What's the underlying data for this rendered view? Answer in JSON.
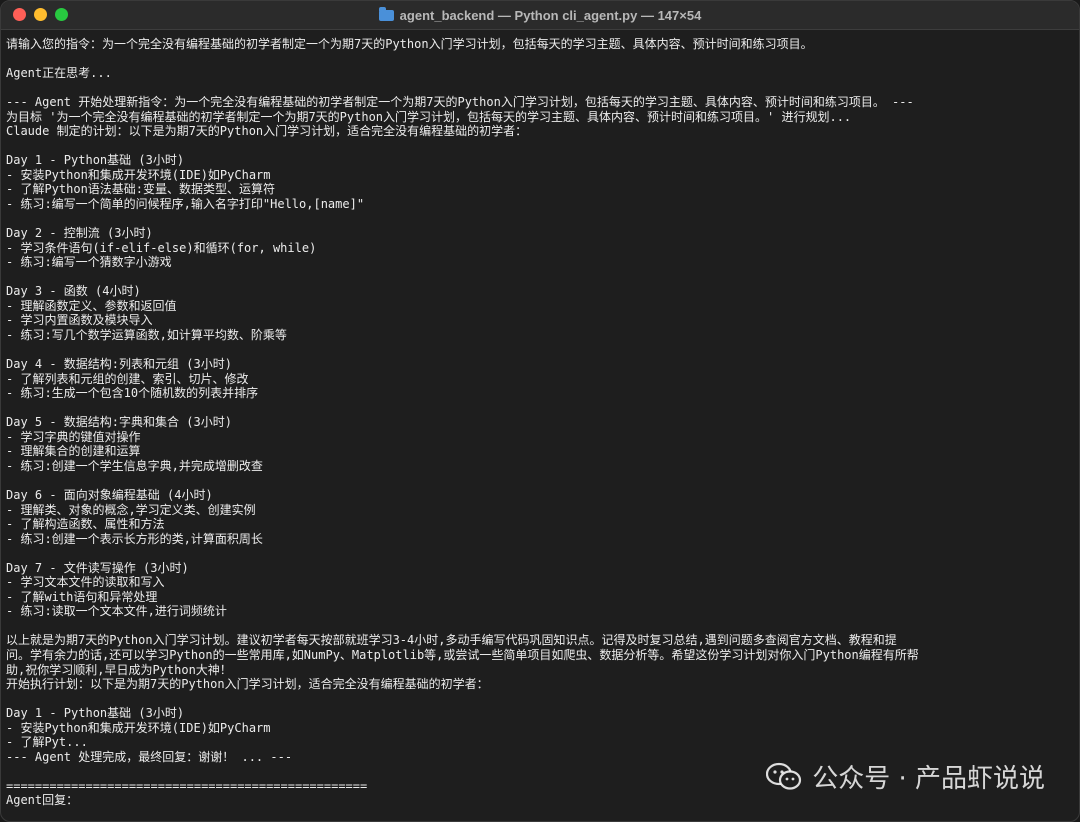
{
  "window": {
    "title": "agent_backend — Python cli_agent.py — 147×54"
  },
  "terminal": {
    "lines": [
      "请输入您的指令：为一个完全没有编程基础的初学者制定一个为期7天的Python入门学习计划，包括每天的学习主题、具体内容、预计时间和练习项目。",
      "",
      "Agent正在思考...",
      "",
      "--- Agent 开始处理新指令：为一个完全没有编程基础的初学者制定一个为期7天的Python入门学习计划，包括每天的学习主题、具体内容、预计时间和练习项目。 ---",
      "为目标 '为一个完全没有编程基础的初学者制定一个为期7天的Python入门学习计划，包括每天的学习主题、具体内容、预计时间和练习项目。' 进行规划...",
      "Claude 制定的计划：以下是为期7天的Python入门学习计划，适合完全没有编程基础的初学者：",
      "",
      "Day 1 - Python基础 (3小时)",
      "- 安装Python和集成开发环境(IDE)如PyCharm",
      "- 了解Python语法基础:变量、数据类型、运算符",
      "- 练习:编写一个简单的问候程序,输入名字打印\"Hello,[name]\"",
      "",
      "Day 2 - 控制流 (3小时)",
      "- 学习条件语句(if-elif-else)和循环(for, while)",
      "- 练习:编写一个猜数字小游戏",
      "",
      "Day 3 - 函数 (4小时)",
      "- 理解函数定义、参数和返回值",
      "- 学习内置函数及模块导入",
      "- 练习:写几个数学运算函数,如计算平均数、阶乘等",
      "",
      "Day 4 - 数据结构:列表和元组 (3小时)",
      "- 了解列表和元组的创建、索引、切片、修改",
      "- 练习:生成一个包含10个随机数的列表并排序",
      "",
      "Day 5 - 数据结构:字典和集合 (3小时)",
      "- 学习字典的键值对操作",
      "- 理解集合的创建和运算",
      "- 练习:创建一个学生信息字典,并完成增删改查",
      "",
      "Day 6 - 面向对象编程基础 (4小时)",
      "- 理解类、对象的概念,学习定义类、创建实例",
      "- 了解构造函数、属性和方法",
      "- 练习:创建一个表示长方形的类,计算面积周长",
      "",
      "Day 7 - 文件读写操作 (3小时)",
      "- 学习文本文件的读取和写入",
      "- 了解with语句和异常处理",
      "- 练习:读取一个文本文件,进行词频统计",
      "",
      "以上就是为期7天的Python入门学习计划。建议初学者每天按部就班学习3-4小时,多动手编写代码巩固知识点。记得及时复习总结,遇到问题多查阅官方文档、教程和提",
      "问。学有余力的话,还可以学习Python的一些常用库,如NumPy、Matplotlib等,或尝试一些简单项目如爬虫、数据分析等。希望这份学习计划对你入门Python编程有所帮",
      "助,祝你学习顺利,早日成为Python大神！",
      "开始执行计划：以下是为期7天的Python入门学习计划，适合完全没有编程基础的初学者：",
      "",
      "Day 1 - Python基础 (3小时)",
      "- 安装Python和集成开发环境(IDE)如PyCharm",
      "- 了解Pyt...",
      "--- Agent 处理完成，最终回复：谢谢！ ... ---",
      "",
      "==================================================",
      "Agent回复："
    ]
  },
  "watermark": {
    "icon": "wechat-icon",
    "text": "公众号 · 产品虾说说"
  },
  "colors": {
    "terminal_bg": "#1e1e1e",
    "terminal_fg": "#ececec",
    "titlebar_bg": "#2b2b2b",
    "close": "#ff5f57",
    "minimize": "#febc2e",
    "maximize": "#28c840"
  }
}
